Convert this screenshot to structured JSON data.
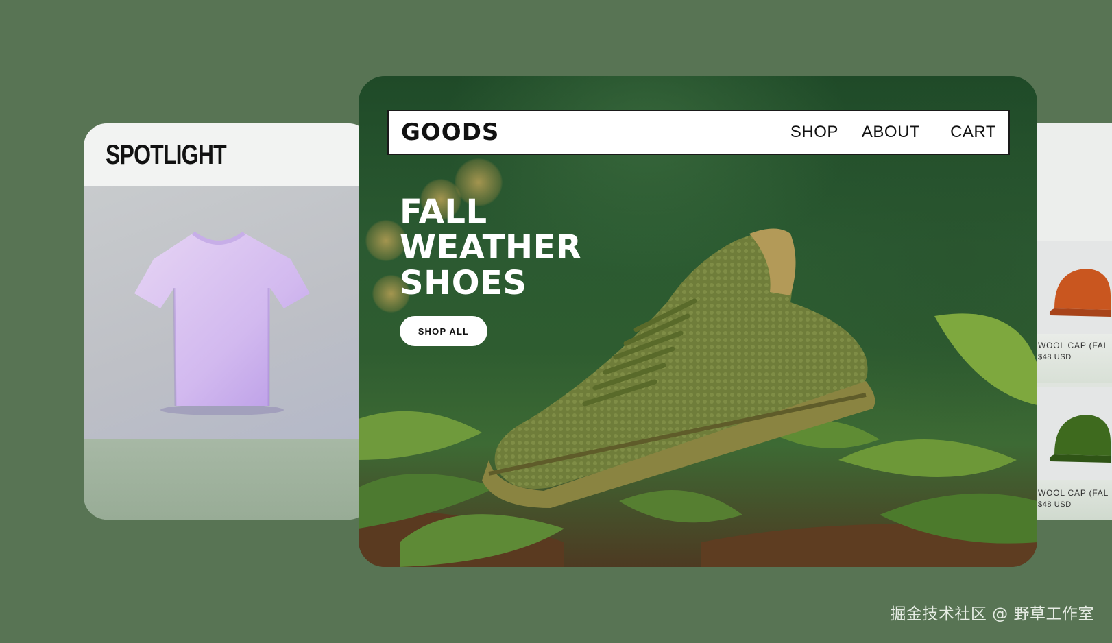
{
  "spotlight": {
    "title": "SPOTLIGHT",
    "image_icon": "tshirt-icon"
  },
  "hero": {
    "nav": {
      "logo": "GOODS",
      "links": [
        "SHOP",
        "ABOUT",
        "CART"
      ]
    },
    "headline": [
      "FALL",
      "WEATHER",
      "SHOES"
    ],
    "cta_label": "SHOP ALL",
    "image_icon": "sneaker-icon"
  },
  "products": [
    {
      "name": "WOOL CAP (FAL",
      "price": "$48 USD",
      "color": "#c9561f",
      "icon": "orange-cap-icon"
    },
    {
      "name": "WOOL CAP (FAL",
      "price": "$48 USD",
      "color": "#3e6a1e",
      "icon": "green-cap-icon"
    }
  ],
  "colors": {
    "background": "#587454",
    "hero_green": "#2b5a31",
    "shoe_olive": "#6d7a3a"
  },
  "watermark": "掘金技术社区 @ 野草工作室"
}
